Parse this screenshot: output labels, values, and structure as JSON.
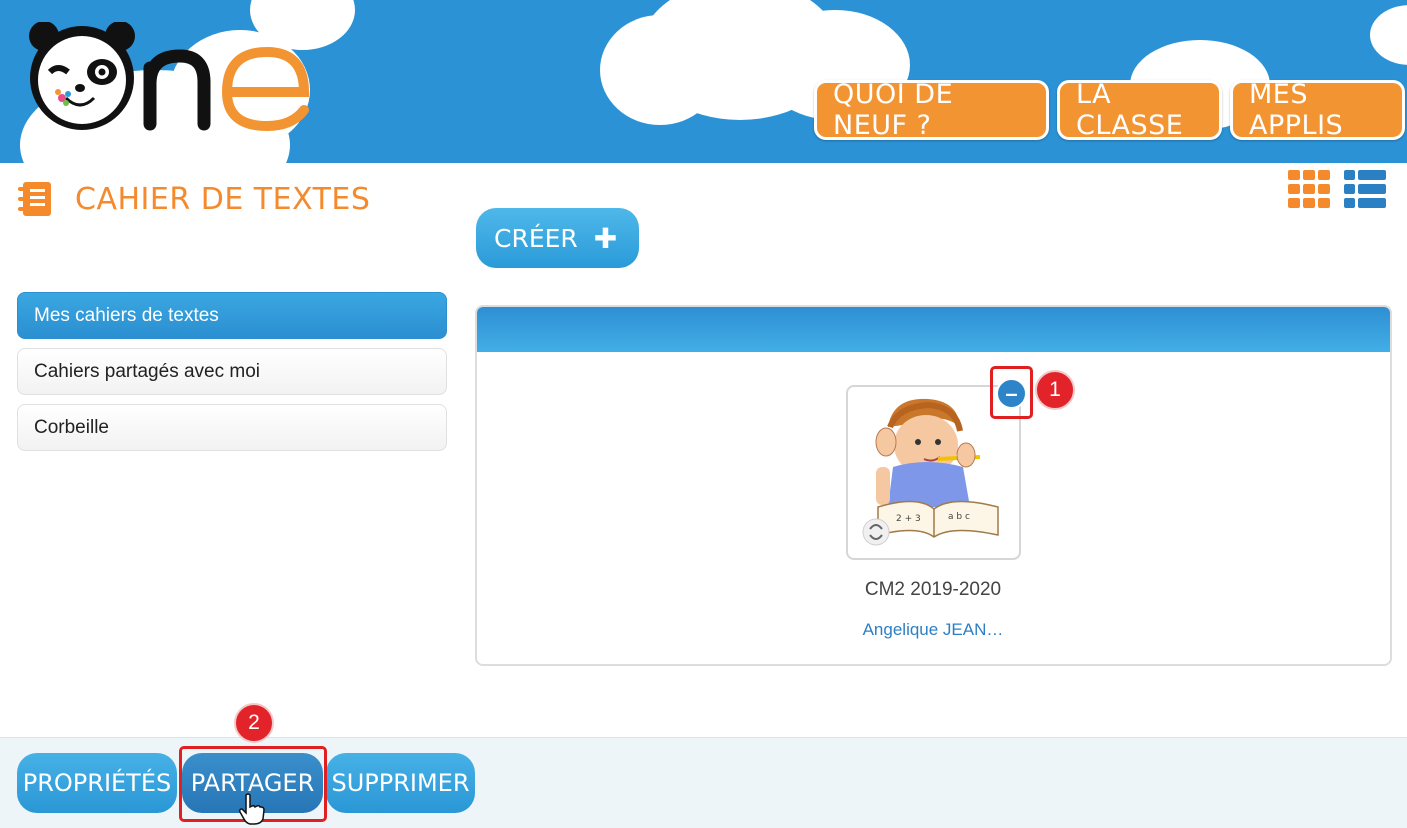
{
  "header": {
    "logo_text": "One",
    "nav": [
      {
        "label": "QUOI DE NEUF ?"
      },
      {
        "label": "LA CLASSE"
      },
      {
        "label": "MES APPLIS"
      }
    ],
    "colors": {
      "header_bg": "#2b92d6",
      "nav_bg": "#f39433"
    }
  },
  "app": {
    "title": "CAHIER DE TEXTES",
    "icon": "notebook-icon",
    "create_label": "CRÉER",
    "view_toggles": [
      "grid-view-icon",
      "list-view-icon"
    ]
  },
  "sidebar": {
    "items": [
      {
        "label": "Mes cahiers de textes",
        "active": true
      },
      {
        "label": "Cahiers partagés avec moi",
        "active": false
      },
      {
        "label": "Corbeille",
        "active": false
      }
    ]
  },
  "notebook": {
    "title": "CM2 2019-2020",
    "owner": "Angelique JEAN…",
    "deselect_symbol": "–"
  },
  "annotations": {
    "step1": "1",
    "step2": "2"
  },
  "toolbar": {
    "properties_label": "PROPRIÉTÉS",
    "share_label": "PARTAGER",
    "delete_label": "SUPPRIMER"
  }
}
